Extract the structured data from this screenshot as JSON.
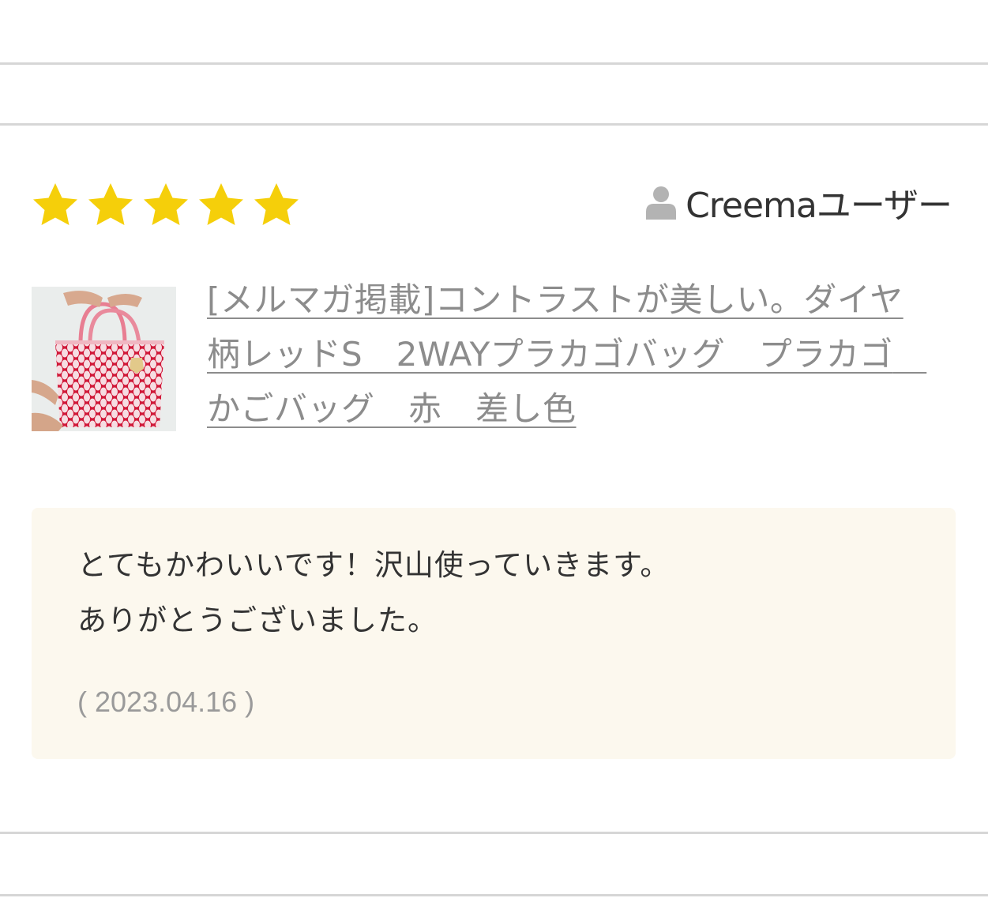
{
  "review": {
    "rating": 5,
    "rating_max": 5,
    "star_color": "#f5cf0a",
    "user_name": "Creemaユーザー",
    "product_title": "[メルマガ掲載]コントラストが美しい。ダイヤ柄レッドS　2WAYプラカゴバッグ　プラカゴ　かごバッグ　赤　差し色",
    "body": "とてもかわいいです！沢山使っていきます。\nありがとうございました。",
    "date": "( 2023.04.16 )",
    "box_color": "#fcf8ee"
  },
  "icons": {
    "star": "star-icon",
    "user": "user-icon",
    "thumbnail": "red-basket-bag-photo"
  }
}
